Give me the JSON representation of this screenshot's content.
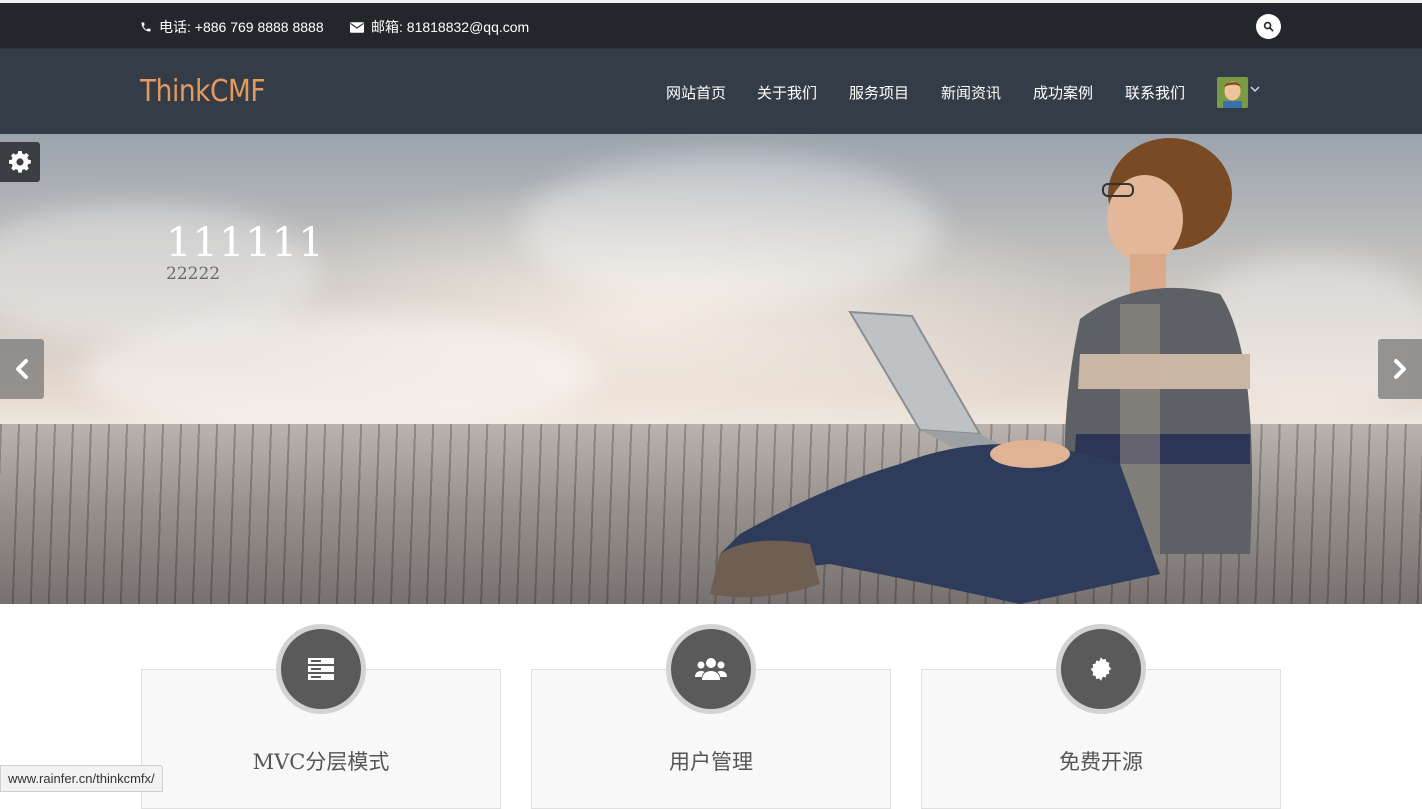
{
  "topbar": {
    "phone_label": "电话: +886 769 8888 8888",
    "email_label": "邮箱: 81818832@qq.com",
    "icons": {
      "phone": "phone-icon",
      "email": "envelope-icon",
      "search": "search-icon"
    }
  },
  "navbar": {
    "logo": "ThinkCMF",
    "items": [
      {
        "label": "网站首页"
      },
      {
        "label": "关于我们"
      },
      {
        "label": "服务项目"
      },
      {
        "label": "新闻资讯"
      },
      {
        "label": "成功案例"
      },
      {
        "label": "联系我们"
      }
    ],
    "avatar_icon": "user-avatar",
    "caret_icon": "chevron-down-icon"
  },
  "hero": {
    "title": "111111",
    "subtitle": "22222",
    "icons": {
      "settings": "gear-icon",
      "prev": "chevron-left-icon",
      "next": "chevron-right-icon"
    }
  },
  "features": [
    {
      "title": "MVC分层模式",
      "icon": "server-icon"
    },
    {
      "title": "用户管理",
      "icon": "users-icon"
    },
    {
      "title": "免费开源",
      "icon": "gear-icon"
    }
  ],
  "status_bar": {
    "url": "www.rainfer.cn/thinkcmfx/"
  },
  "colors": {
    "topbar_bg": "#23272c",
    "navbar_bg": "#343d47",
    "logo": "#e49a5c",
    "feature_icon_bg": "#5a5a5a"
  }
}
